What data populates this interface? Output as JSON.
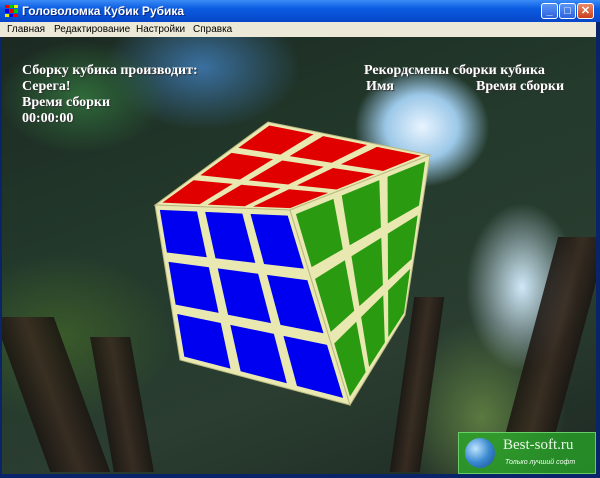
{
  "window": {
    "title": "Головоломка Кубик Рубика",
    "buttons": {
      "minimize": "_",
      "maximize": "□",
      "close": "✕"
    }
  },
  "menu": [
    "Главная",
    "Редактирование",
    "Настройки",
    "Справка"
  ],
  "overlay": {
    "solver_label": "Сборку кубика производит:",
    "solver_name": "Серега!",
    "time_label": "Время сборки",
    "time_value": "00:00:00",
    "records_title": "Рекордсмены сборки кубика",
    "records_col_name": "Имя",
    "records_col_time": "Время сборки"
  },
  "cube": {
    "top_color": "#e00000",
    "front_color": "#0000f0",
    "right_color": "#2a9a10",
    "edge_color": "#e8e8b0"
  },
  "watermark": {
    "site": "Best-soft.ru",
    "tagline": "Только лучший софт"
  }
}
